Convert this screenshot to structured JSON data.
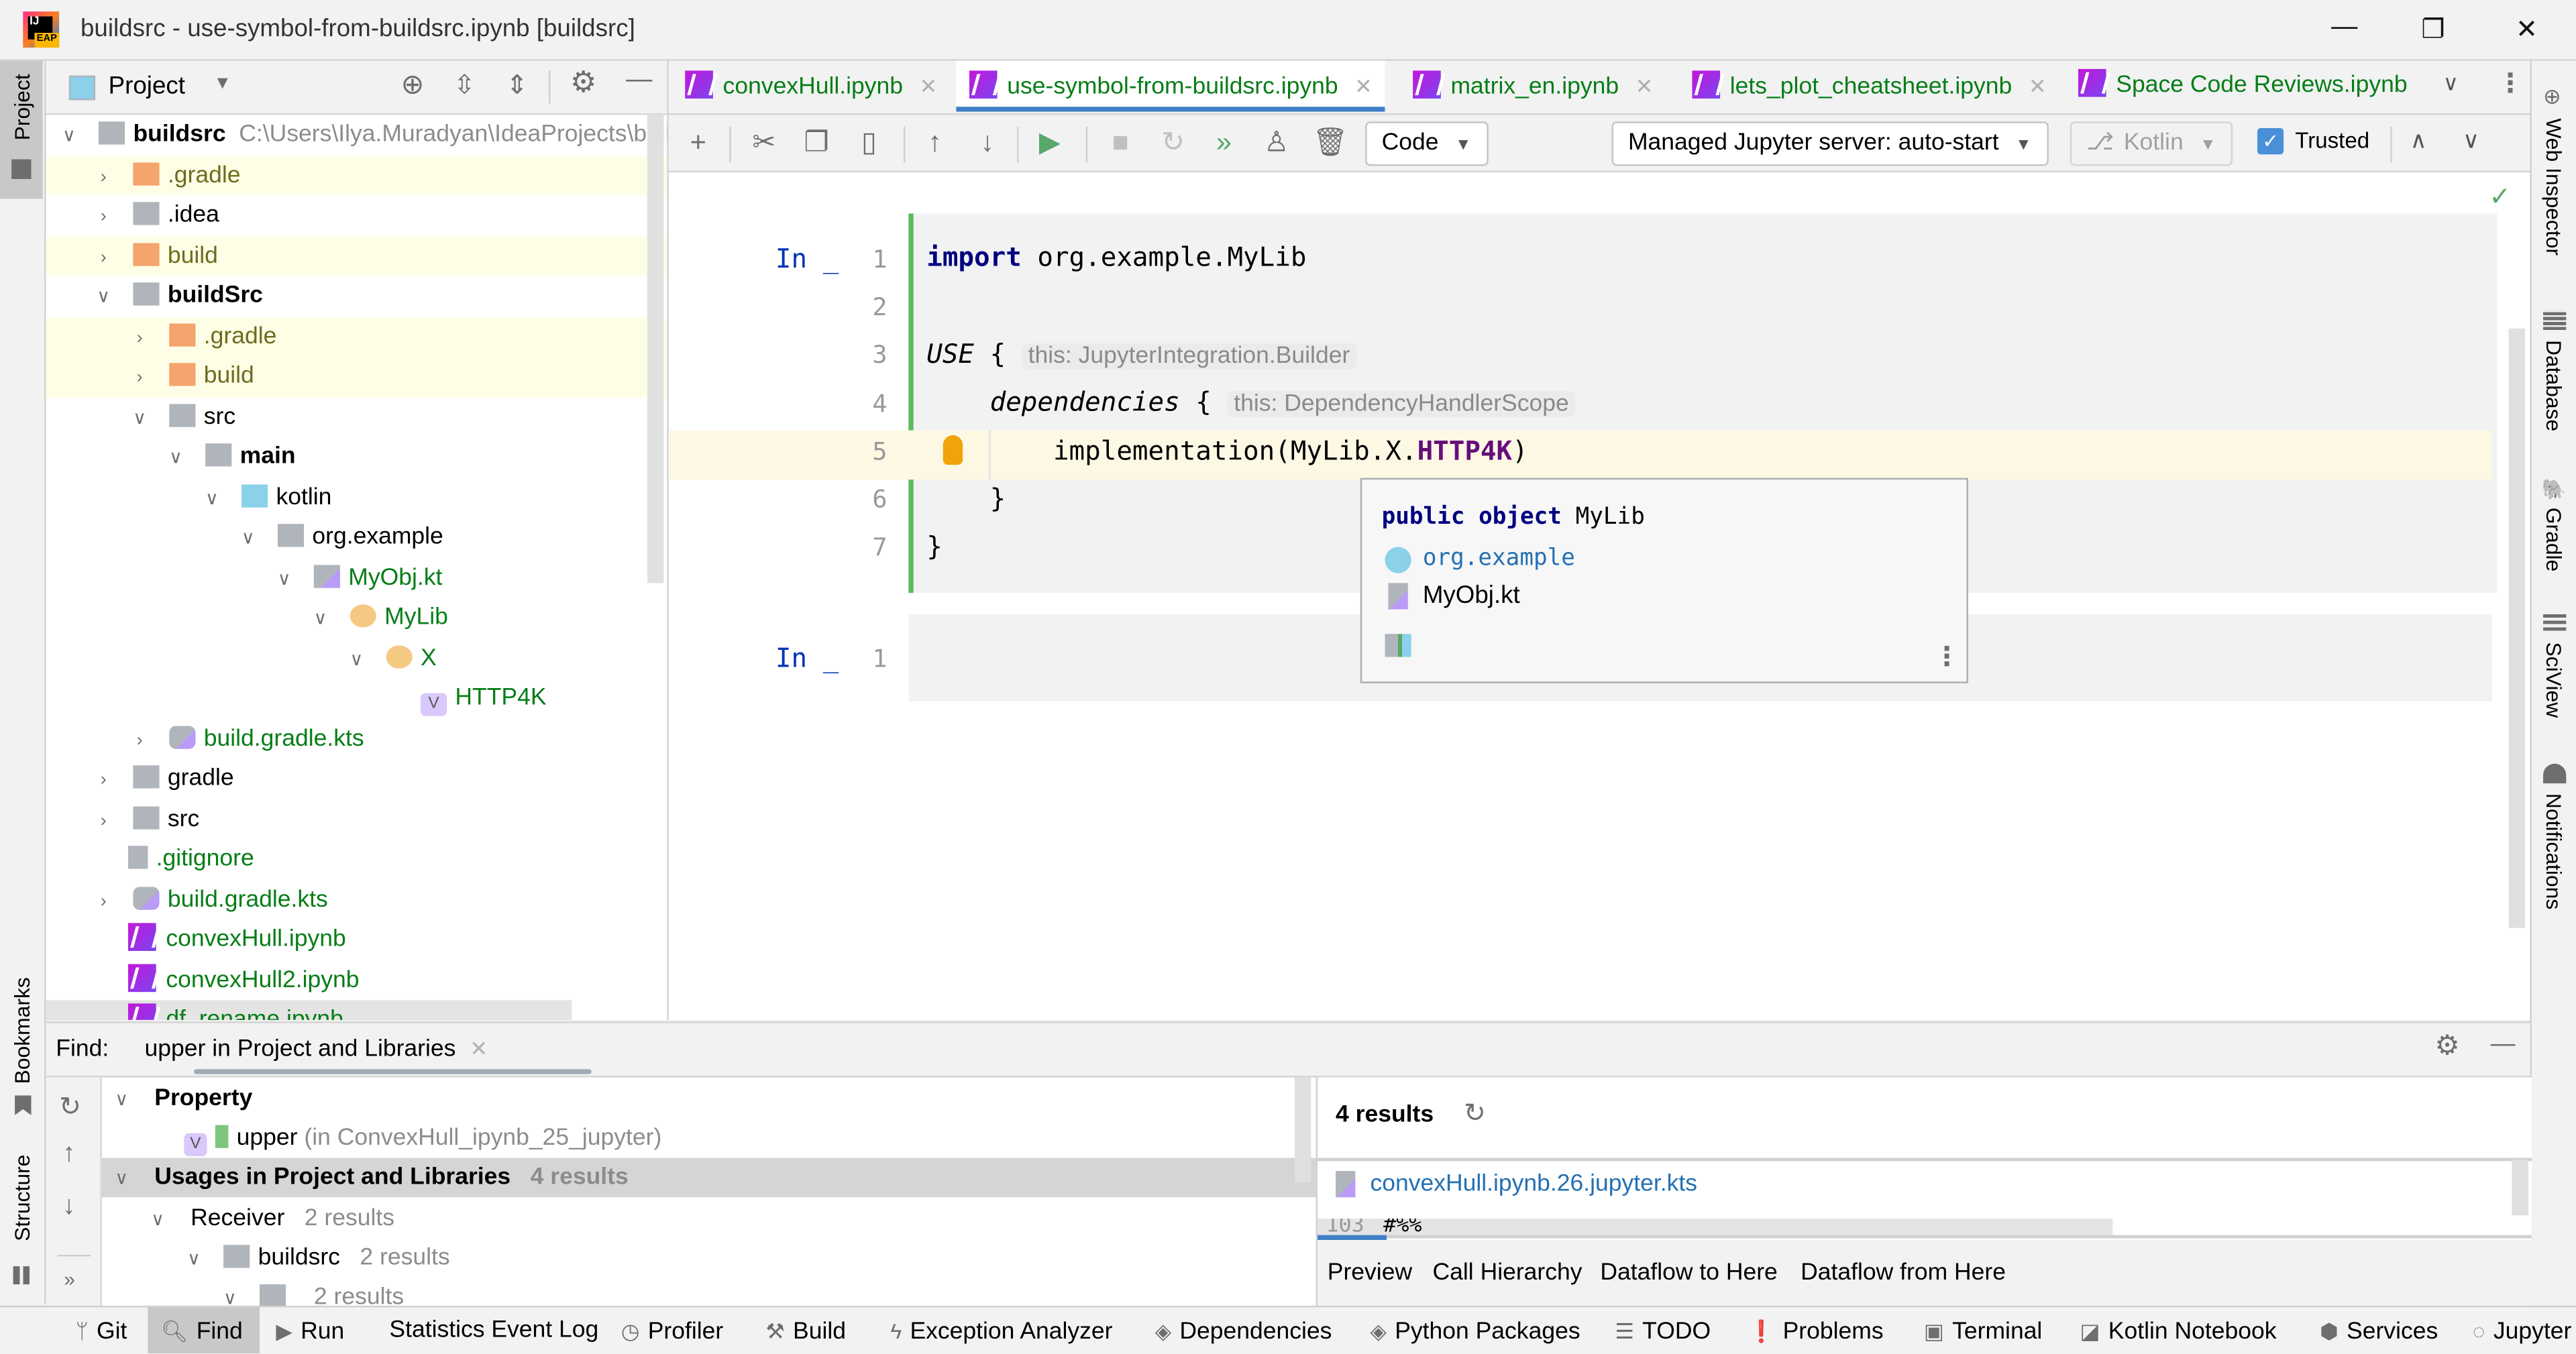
{
  "window": {
    "title": "buildsrc - use-symbol-from-buildsrc.ipynb [buildsrc]",
    "logo_text": "IJ",
    "logo_badge": "EAP",
    "minimize_icon": "—",
    "restore_icon": "❐",
    "close_icon": "✕"
  },
  "left_stripe": {
    "project": "Project",
    "bookmarks": "Bookmarks",
    "structure": "Structure"
  },
  "project_panel": {
    "view_label": "Project",
    "tree": [
      {
        "label": "buildsrc",
        "path": "C:\\Users\\Ilya.Muradyan\\IdeaProjects\\buil",
        "bold": true
      },
      {
        "label": ".gradle"
      },
      {
        "label": ".idea"
      },
      {
        "label": "build"
      },
      {
        "label": "buildSrc",
        "bold": true
      },
      {
        "label": ".gradle"
      },
      {
        "label": "build"
      },
      {
        "label": "src"
      },
      {
        "label": "main",
        "bold": true
      },
      {
        "label": "kotlin"
      },
      {
        "label": "org.example"
      },
      {
        "label": "MyObj.kt"
      },
      {
        "label": "MyLib"
      },
      {
        "label": "X"
      },
      {
        "label": "HTTP4K"
      },
      {
        "label": "build.gradle.kts"
      },
      {
        "label": "gradle"
      },
      {
        "label": "src"
      },
      {
        "label": ".gitignore"
      },
      {
        "label": "build.gradle.kts"
      },
      {
        "label": "convexHull.ipynb"
      },
      {
        "label": "convexHull2.ipynb"
      },
      {
        "label": "df_rename.ipynb"
      }
    ]
  },
  "editor_tabs": [
    {
      "label": "convexHull.ipynb",
      "active": false
    },
    {
      "label": "use-symbol-from-buildsrc.ipynb",
      "active": true
    },
    {
      "label": "matrix_en.ipynb",
      "active": false
    },
    {
      "label": "lets_plot_cheatsheet.ipynb",
      "active": false
    },
    {
      "label": "Space Code Reviews.ipynb",
      "active": false
    }
  ],
  "notebook_toolbar": {
    "cell_type": "Code",
    "server": "Managed Jupyter server: auto-start",
    "kernel": "Kotlin",
    "trusted_label": "Trusted",
    "trusted_checked": true
  },
  "cells": [
    {
      "prompt": "In _",
      "lines": [
        {
          "num": "1",
          "parts": [
            {
              "t": "import",
              "kw": true
            },
            {
              "t": " org.example.MyLib"
            }
          ]
        },
        {
          "num": "2",
          "parts": []
        },
        {
          "num": "3",
          "parts": [
            {
              "t": "USE",
              "italic": true
            },
            {
              "t": " {"
            }
          ],
          "hint": "this: JupyterIntegration.Builder"
        },
        {
          "num": "4",
          "parts": [
            {
              "t": "    "
            },
            {
              "t": "dependencies",
              "italic": true
            },
            {
              "t": " {"
            }
          ],
          "hint": "this: DependencyHandlerScope"
        },
        {
          "num": "5",
          "parts": [
            {
              "t": "        implementation(MyLib.X."
            },
            {
              "t": "HTTP4K",
              "field": true
            },
            {
              "t": ")"
            }
          ]
        },
        {
          "num": "6",
          "parts": [
            {
              "t": "    }"
            }
          ]
        },
        {
          "num": "7",
          "parts": [
            {
              "t": "}"
            }
          ]
        }
      ]
    },
    {
      "prompt": "In _",
      "lines": [
        {
          "num": "1",
          "parts": []
        }
      ]
    }
  ],
  "quick_doc_popup": {
    "signature_kw": "public object",
    "signature_name": "MyLib",
    "package": "org.example",
    "file": "MyObj.kt"
  },
  "right_stripe": [
    "Web Inspector",
    "Database",
    "Gradle",
    "SciView",
    "Notifications"
  ],
  "find_panel": {
    "label": "Find:",
    "tab": "upper in Project and Libraries",
    "tree": [
      {
        "label": "Property",
        "bold": true
      },
      {
        "label": "upper",
        "extra": "(in ConvexHull_ipynb_25_jupyter)"
      },
      {
        "label": "Usages in Project and Libraries",
        "count": "4 results",
        "bold": true
      },
      {
        "label": "Receiver",
        "count": "2 results"
      },
      {
        "label": "buildsrc",
        "count": "2 results"
      },
      {
        "label": "",
        "count": "2 results"
      }
    ],
    "results_count": "4 results",
    "result_file": "convexHull.ipynb.26.jupyter.kts",
    "preview_line_num": "103",
    "preview_line_text": "#%%",
    "preview_tabs": [
      "Preview",
      "Call Hierarchy",
      "Dataflow to Here",
      "Dataflow from Here"
    ]
  },
  "bottom_bar": [
    {
      "label": "Git",
      "icon": "git-branch"
    },
    {
      "label": "Find",
      "icon": "search",
      "active": true
    },
    {
      "label": "Run",
      "icon": "play"
    },
    {
      "label": "Statistics Event Log",
      "icon": ""
    },
    {
      "label": "Profiler",
      "icon": "profiler"
    },
    {
      "label": "Build",
      "icon": "hammer"
    },
    {
      "label": "Exception Analyzer",
      "icon": "lightning"
    },
    {
      "label": "Dependencies",
      "icon": "layers"
    },
    {
      "label": "Python Packages",
      "icon": "layers"
    },
    {
      "label": "TODO",
      "icon": "list"
    },
    {
      "label": "Problems",
      "icon": "warning"
    },
    {
      "label": "Terminal",
      "icon": "terminal"
    },
    {
      "label": "Kotlin Notebook",
      "icon": "notebook"
    },
    {
      "label": "Services",
      "icon": "services"
    },
    {
      "label": "Jupyter",
      "icon": "jupyter"
    }
  ],
  "colors": {
    "accent_blue": "#3f80c6",
    "vcs_green": "#067d17",
    "keyword_navy": "#000080",
    "field_purple": "#660e7a",
    "cell_bar_green": "#5fb85f",
    "ignored_bg": "#fefee6",
    "caret_row_bg": "#fdf8e4"
  }
}
